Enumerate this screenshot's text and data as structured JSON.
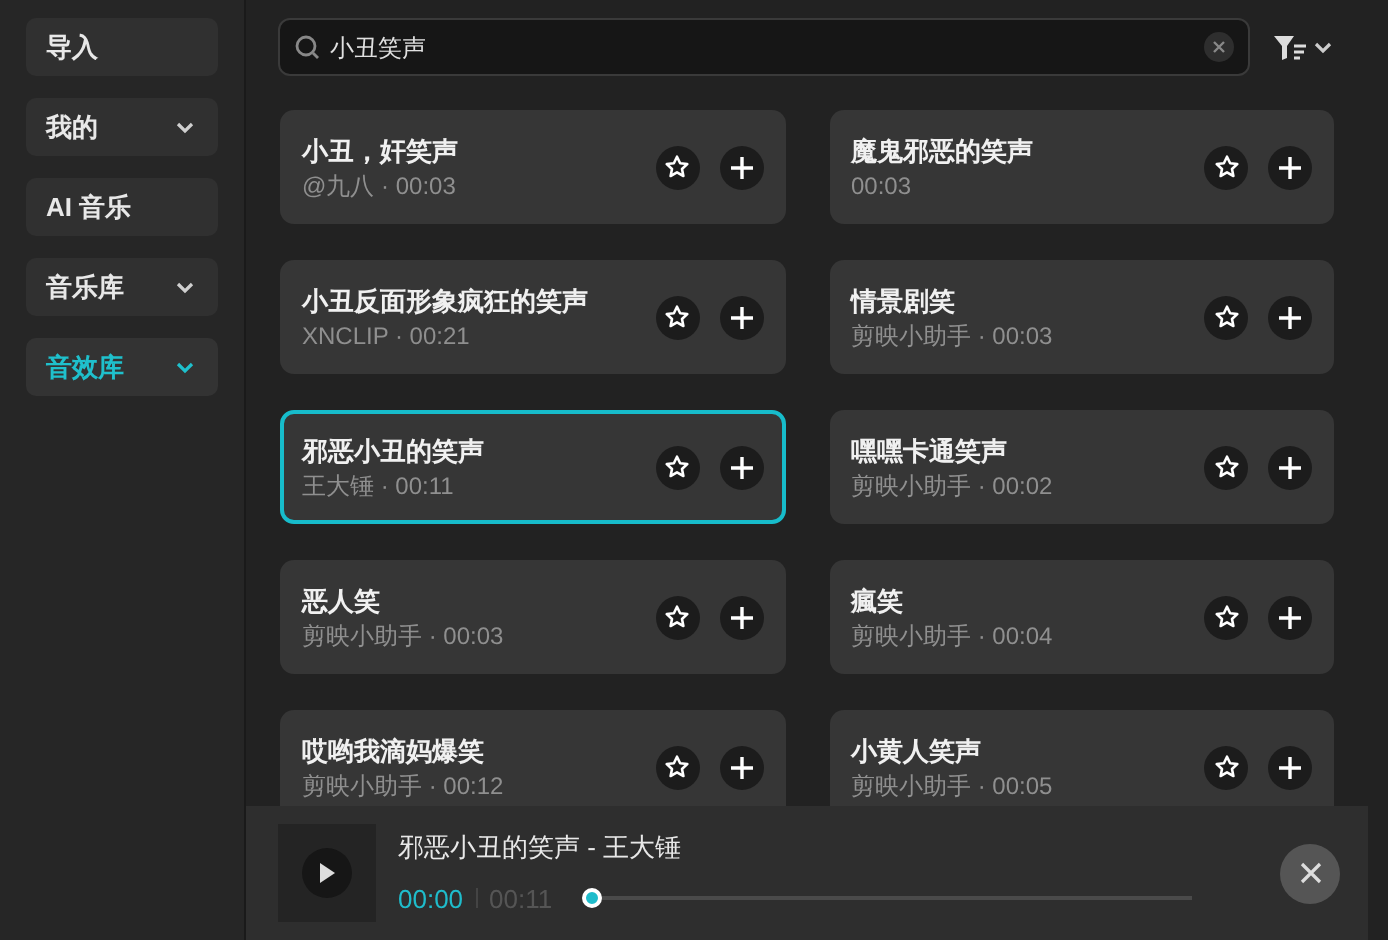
{
  "sidebar": {
    "items": [
      {
        "label": "导入",
        "has_menu": false,
        "selected": false
      },
      {
        "label": "我的",
        "has_menu": true,
        "selected": false
      },
      {
        "label": "AI 音乐",
        "has_menu": false,
        "selected": false
      },
      {
        "label": "音乐库",
        "has_menu": true,
        "selected": false
      },
      {
        "label": "音效库",
        "has_menu": true,
        "selected": true
      }
    ]
  },
  "search": {
    "value": "小丑笑声"
  },
  "sounds": [
    {
      "title": "小丑，奸笑声",
      "meta": "@九八 · 00:03",
      "selected": false
    },
    {
      "title": "魔鬼邪恶的笑声",
      "meta": "00:03",
      "selected": false
    },
    {
      "title": "小丑反面形象疯狂的笑声",
      "meta": "XNCLIP · 00:21",
      "selected": false
    },
    {
      "title": "情景剧笑",
      "meta": "剪映小助手 · 00:03",
      "selected": false
    },
    {
      "title": "邪恶小丑的笑声",
      "meta": "王大锤 · 00:11",
      "selected": true
    },
    {
      "title": "嘿嘿卡通笑声",
      "meta": "剪映小助手 · 00:02",
      "selected": false
    },
    {
      "title": "恶人笑",
      "meta": "剪映小助手 · 00:03",
      "selected": false
    },
    {
      "title": "瘋笑",
      "meta": "剪映小助手 · 00:04",
      "selected": false
    },
    {
      "title": "哎哟我滴妈爆笑",
      "meta": "剪映小助手 · 00:12",
      "selected": false
    },
    {
      "title": "小黄人笑声",
      "meta": "剪映小助手 · 00:05",
      "selected": false
    }
  ],
  "player": {
    "title": "邪恶小丑的笑声 - 王大锤",
    "current": "00:00",
    "duration": "00:11",
    "level": 0
  }
}
